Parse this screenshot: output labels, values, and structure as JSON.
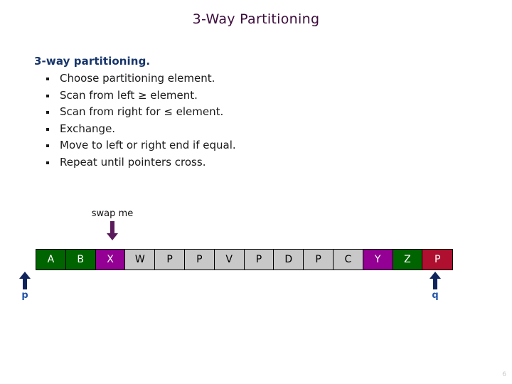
{
  "slide": {
    "title": "3-Way Partitioning",
    "page_number": "6",
    "title_color": "#3B0B3B",
    "background": "#ffffff"
  },
  "content": {
    "lead_line": "3-way partitioning.",
    "lead_color": "#17356B",
    "bullets": [
      {
        "text": "Choose partitioning element."
      },
      {
        "text": "Scan from left ≥ element."
      },
      {
        "text": "Scan from right for ≤ element."
      },
      {
        "text": "Exchange."
      },
      {
        "text": "Move to left or right end if equal."
      },
      {
        "text": "Repeat until pointers cross."
      }
    ]
  },
  "annotation": {
    "swap_label": "swap me",
    "arrow_color": "#5B1A5B"
  },
  "array": {
    "palette": {
      "green_bg": "#006400",
      "green_fg": "#ffffff",
      "magenta_bg": "#930093",
      "magenta_fg": "#ffffff",
      "gray_bg": "#c8c8c8",
      "gray_fg": "#000000",
      "red_bg": "#B01030",
      "red_fg": "#ffffff"
    },
    "cells": [
      {
        "value": "A",
        "bg": "#006400",
        "fg": "#ffffff"
      },
      {
        "value": "B",
        "bg": "#006400",
        "fg": "#ffffff"
      },
      {
        "value": "X",
        "bg": "#930093",
        "fg": "#ffffff"
      },
      {
        "value": "W",
        "bg": "#c8c8c8",
        "fg": "#000000"
      },
      {
        "value": "P",
        "bg": "#c8c8c8",
        "fg": "#000000"
      },
      {
        "value": "P",
        "bg": "#c8c8c8",
        "fg": "#000000"
      },
      {
        "value": "V",
        "bg": "#c8c8c8",
        "fg": "#000000"
      },
      {
        "value": "P",
        "bg": "#c8c8c8",
        "fg": "#000000"
      },
      {
        "value": "D",
        "bg": "#c8c8c8",
        "fg": "#000000"
      },
      {
        "value": "P",
        "bg": "#c8c8c8",
        "fg": "#000000"
      },
      {
        "value": "C",
        "bg": "#c8c8c8",
        "fg": "#000000"
      },
      {
        "value": "Y",
        "bg": "#930093",
        "fg": "#ffffff"
      },
      {
        "value": "Z",
        "bg": "#006400",
        "fg": "#ffffff"
      },
      {
        "value": "P",
        "bg": "#B01030",
        "fg": "#ffffff"
      }
    ]
  },
  "pointers": {
    "left": {
      "label": "p",
      "color": "#2255AA"
    },
    "right": {
      "label": "q",
      "color": "#2255AA"
    }
  }
}
